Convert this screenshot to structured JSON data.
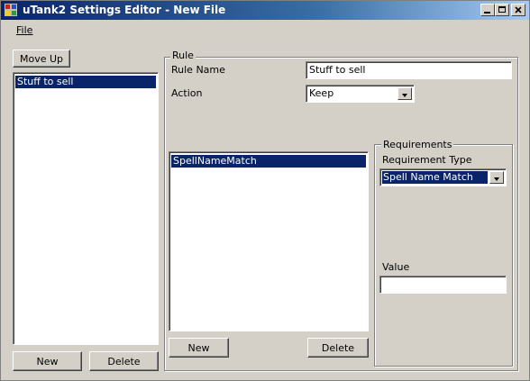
{
  "window": {
    "title": "uTank2 Settings Editor - New File"
  },
  "menu": {
    "file_label": "File"
  },
  "left_panel": {
    "move_up_label": "Move Up",
    "rules": [
      "Stuff to sell"
    ],
    "new_label": "New",
    "delete_label": "Delete"
  },
  "rule_group": {
    "title": "Rule",
    "rule_name_label": "Rule Name",
    "rule_name_value": "Stuff to sell",
    "action_label": "Action",
    "action_value": "Keep",
    "requirements_list": [
      "SpellNameMatch"
    ],
    "new_label": "New",
    "delete_label": "Delete"
  },
  "requirements_group": {
    "title": "Requirements",
    "type_label": "Requirement Type",
    "type_value": "Spell Name Match",
    "value_label": "Value",
    "value_value": ""
  }
}
